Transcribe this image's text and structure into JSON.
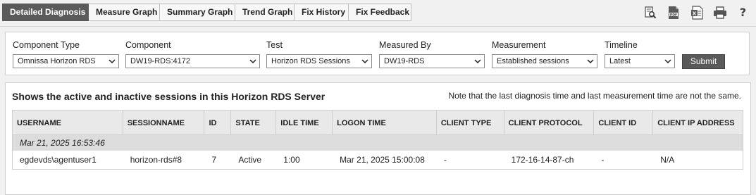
{
  "tabs": [
    {
      "label": "Detailed Diagnosis",
      "active": true
    },
    {
      "label": "Measure Graph",
      "active": false
    },
    {
      "label": "Summary Graph",
      "active": false
    },
    {
      "label": "Trend Graph",
      "active": false
    },
    {
      "label": "Fix History",
      "active": false
    },
    {
      "label": "Fix Feedback",
      "active": false
    }
  ],
  "toolbar": {
    "icons": [
      "search-report-icon",
      "pdf-icon",
      "excel-icon",
      "print-icon",
      "help-icon"
    ],
    "help_label": "?"
  },
  "filters": {
    "component_type": {
      "label": "Component Type",
      "value": "Omnissa Horizon RDS"
    },
    "component": {
      "label": "Component",
      "value": "DW19-RDS:4172"
    },
    "test": {
      "label": "Test",
      "value": "Horizon RDS Sessions"
    },
    "measured_by": {
      "label": "Measured By",
      "value": "DW19-RDS"
    },
    "measurement": {
      "label": "Measurement",
      "value": "Established sessions"
    },
    "timeline": {
      "label": "Timeline",
      "value": "Latest"
    },
    "submit_label": "Submit"
  },
  "results": {
    "title": "Shows the active and inactive sessions in this Horizon RDS Server",
    "note": "Note that the last diagnosis time and last measurement time are not the same.",
    "columns": [
      "USERNAME",
      "SESSIONNAME",
      "ID",
      "STATE",
      "IDLE TIME",
      "LOGON TIME",
      "CLIENT TYPE",
      "CLIENT PROTOCOL",
      "CLIENT ID",
      "CLIENT IP ADDRESS"
    ],
    "group_time": "Mar 21, 2025 16:53:46",
    "rows": [
      [
        "egdevds\\agentuser1",
        "horizon-rds#8",
        "7",
        "Active",
        "1:00",
        "Mar 21, 2025 15:00:08",
        "-",
        "172-16-14-87-ch",
        "-",
        "N/A"
      ]
    ]
  },
  "colors": {
    "active_tab": "#5a5a5a",
    "header_bg": "#e9e9e9",
    "group_bg": "#dcdcdc"
  }
}
